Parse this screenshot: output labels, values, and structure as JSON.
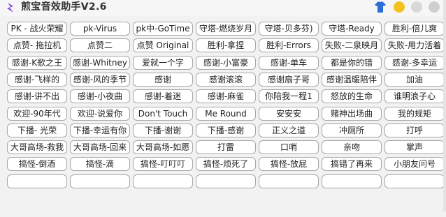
{
  "app": {
    "title": "煎宝音效助手V2.6"
  },
  "colors": {
    "minimize": "#f4c21f",
    "accent": "#8a4fd8",
    "skin": "#2b6fd6"
  },
  "icons": {
    "app": "lightning-icon",
    "skin": "shirt-icon",
    "minimize": "circle-icon",
    "maximize": "circle-icon",
    "close": "circle-icon"
  },
  "buttons": [
    [
      "PK - 战火荣耀",
      "pk-Virus",
      "pk中-GoTime",
      "守塔-燃烧岁月",
      "守塔-贝多芬)",
      "守塔-Ready",
      "胜利-倍儿爽"
    ],
    [
      "点赞- 拖拉机",
      "点赞二",
      "点赞 Original",
      "胜利-拿捏",
      "胜利-Errors",
      "失败-二泉映月",
      "失败-用力活着"
    ],
    [
      "感谢-K歌之王",
      "感谢-Whitney",
      "爱就一个字",
      "感谢-小富豪",
      "感谢-单车",
      "都是你的错",
      "感谢-多幸运"
    ],
    [
      "感谢-飞样的",
      "感谢-风的季节",
      "感谢",
      "感谢滚滚",
      "感谢扇子哥",
      "感谢温暖陪伴",
      "加油"
    ],
    [
      "感谢-讲不出",
      "感谢-小夜曲",
      "感谢-着迷",
      "感谢-麻雀",
      "你陪我一程1",
      "怒放的生命",
      "谁明浪子心"
    ],
    [
      "欢迎-90年代",
      "欢迎-说爱你",
      "Don't Touch",
      "Me Round",
      "安安安",
      "赌神出场曲",
      "我的规矩"
    ],
    [
      "下播- 光荣",
      "下播-幸运有你",
      "下播-谢谢",
      "下播-感谢",
      "正义之道",
      "冲厕所",
      "打呼"
    ],
    [
      "大哥高场-救我",
      "大哥高场-回来",
      "大哥高场-如愿",
      "打雷",
      "口哨",
      "亲吻",
      "掌声"
    ],
    [
      "搞怪-倒酒",
      "搞怪-滴",
      "搞怪-叮叮叮",
      "搞怪-烦死了",
      "搞怪-放屁",
      "搞错了再来",
      "小朋友问号"
    ],
    [
      "",
      "",
      "",
      "",
      "",
      "",
      ""
    ]
  ]
}
